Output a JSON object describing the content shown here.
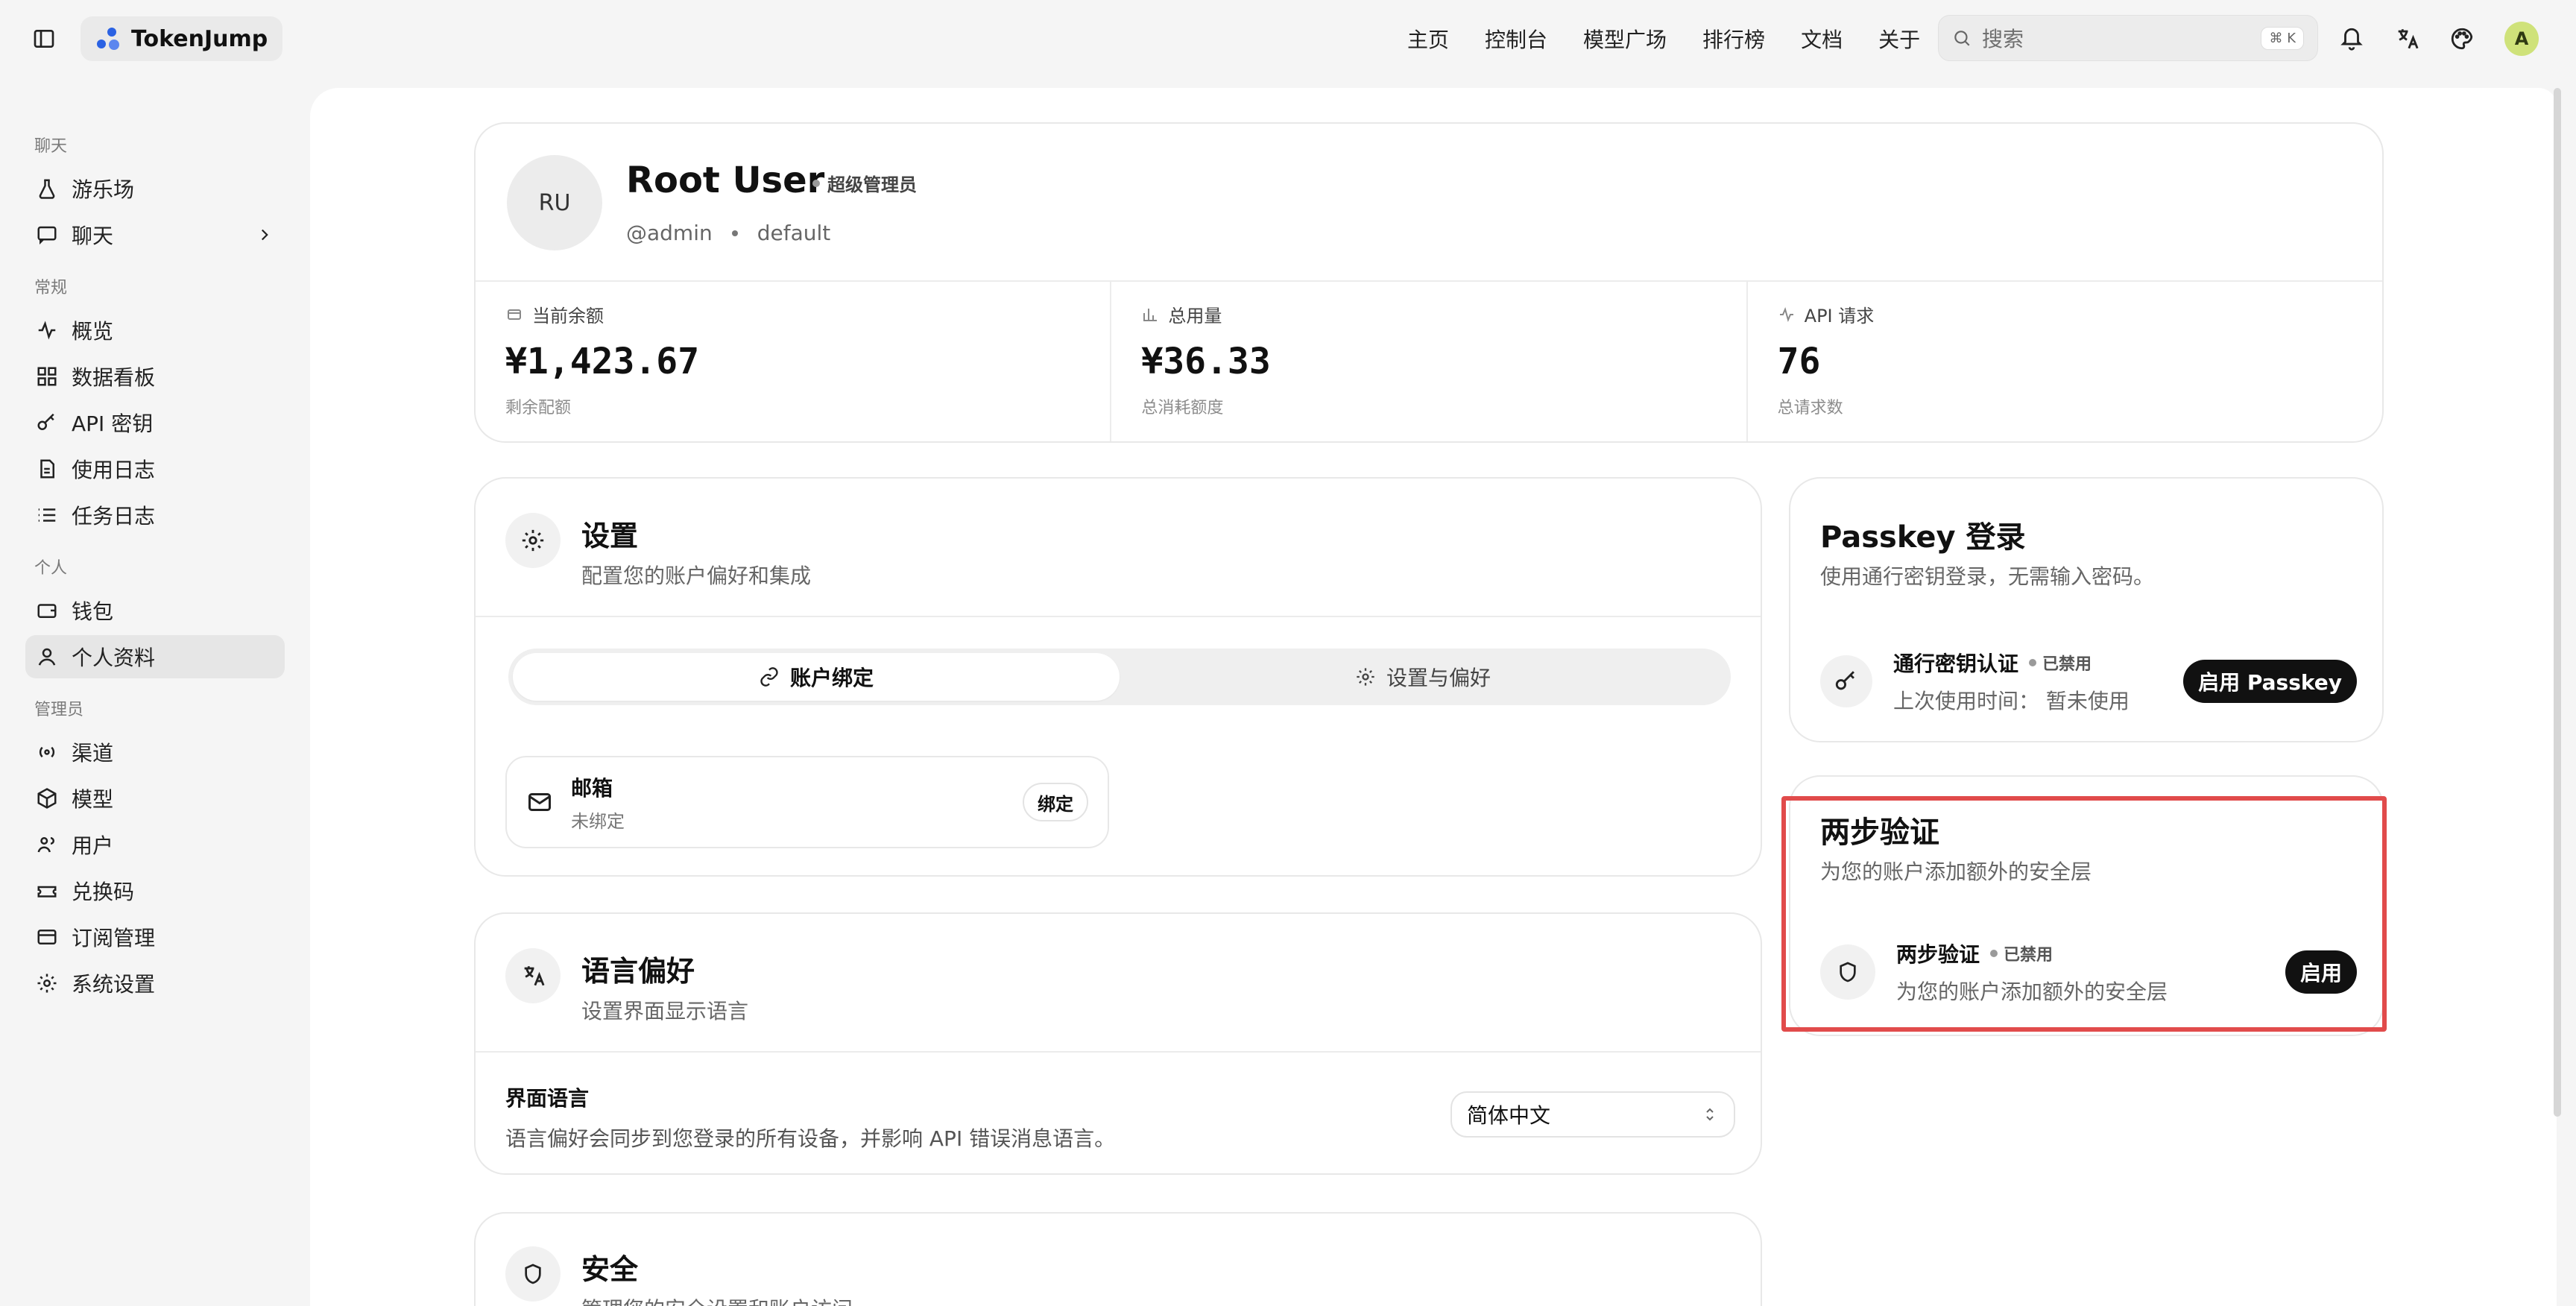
{
  "brand": {
    "name": "TokenJump"
  },
  "topnav": {
    "items": [
      "主页",
      "控制台",
      "模型广场",
      "排行榜",
      "文档",
      "关于"
    ],
    "search_placeholder": "搜索",
    "search_shortcut": "⌘ K",
    "avatar_letter": "A"
  },
  "sidebar": {
    "groups": [
      {
        "title": "聊天",
        "items": [
          {
            "label": "游乐场"
          },
          {
            "label": "聊天"
          }
        ]
      },
      {
        "title": "常规",
        "items": [
          {
            "label": "概览"
          },
          {
            "label": "数据看板"
          },
          {
            "label": "API 密钥"
          },
          {
            "label": "使用日志"
          },
          {
            "label": "任务日志"
          }
        ]
      },
      {
        "title": "个人",
        "items": [
          {
            "label": "钱包"
          },
          {
            "label": "个人资料"
          }
        ]
      },
      {
        "title": "管理员",
        "items": [
          {
            "label": "渠道"
          },
          {
            "label": "模型"
          },
          {
            "label": "用户"
          },
          {
            "label": "兑换码"
          },
          {
            "label": "订阅管理"
          },
          {
            "label": "系统设置"
          }
        ]
      }
    ]
  },
  "profile": {
    "initials": "RU",
    "name": "Root User",
    "role": "超级管理员",
    "handle": "@admin",
    "group": "default",
    "stats": [
      {
        "label": "当前余额",
        "value": "¥1,423.67",
        "sub": "剩余配额"
      },
      {
        "label": "总用量",
        "value": "¥36.33",
        "sub": "总消耗额度"
      },
      {
        "label": "API 请求",
        "value": "76",
        "sub": "总请求数"
      }
    ]
  },
  "settings": {
    "title": "设置",
    "subtitle": "配置您的账户偏好和集成",
    "tabs": [
      {
        "label": "账户绑定"
      },
      {
        "label": "设置与偏好"
      }
    ],
    "email": {
      "title": "邮箱",
      "status": "未绑定",
      "button": "绑定"
    }
  },
  "language": {
    "title": "语言偏好",
    "subtitle": "设置界面显示语言",
    "row_title": "界面语言",
    "row_desc": "语言偏好会同步到您登录的所有设备，并影响 API 错误消息语言。",
    "selected": "简体中文"
  },
  "security": {
    "title": "安全",
    "subtitle": "管理您的安全设置和账户访问"
  },
  "passkey": {
    "title": "Passkey 登录",
    "subtitle": "使用通行密钥登录，无需输入密码。",
    "row_title": "通行密钥认证",
    "status": "已禁用",
    "last_used_label": "上次使用时间：",
    "last_used_value": "暂未使用",
    "button": "启用 Passkey"
  },
  "twofa": {
    "title": "两步验证",
    "subtitle": "为您的账户添加额外的安全层",
    "row_title": "两步验证",
    "status": "已禁用",
    "row_desc": "为您的账户添加额外的安全层",
    "button": "启用"
  },
  "colors": {
    "highlight": "#e14b4b",
    "accent": "#111111"
  }
}
